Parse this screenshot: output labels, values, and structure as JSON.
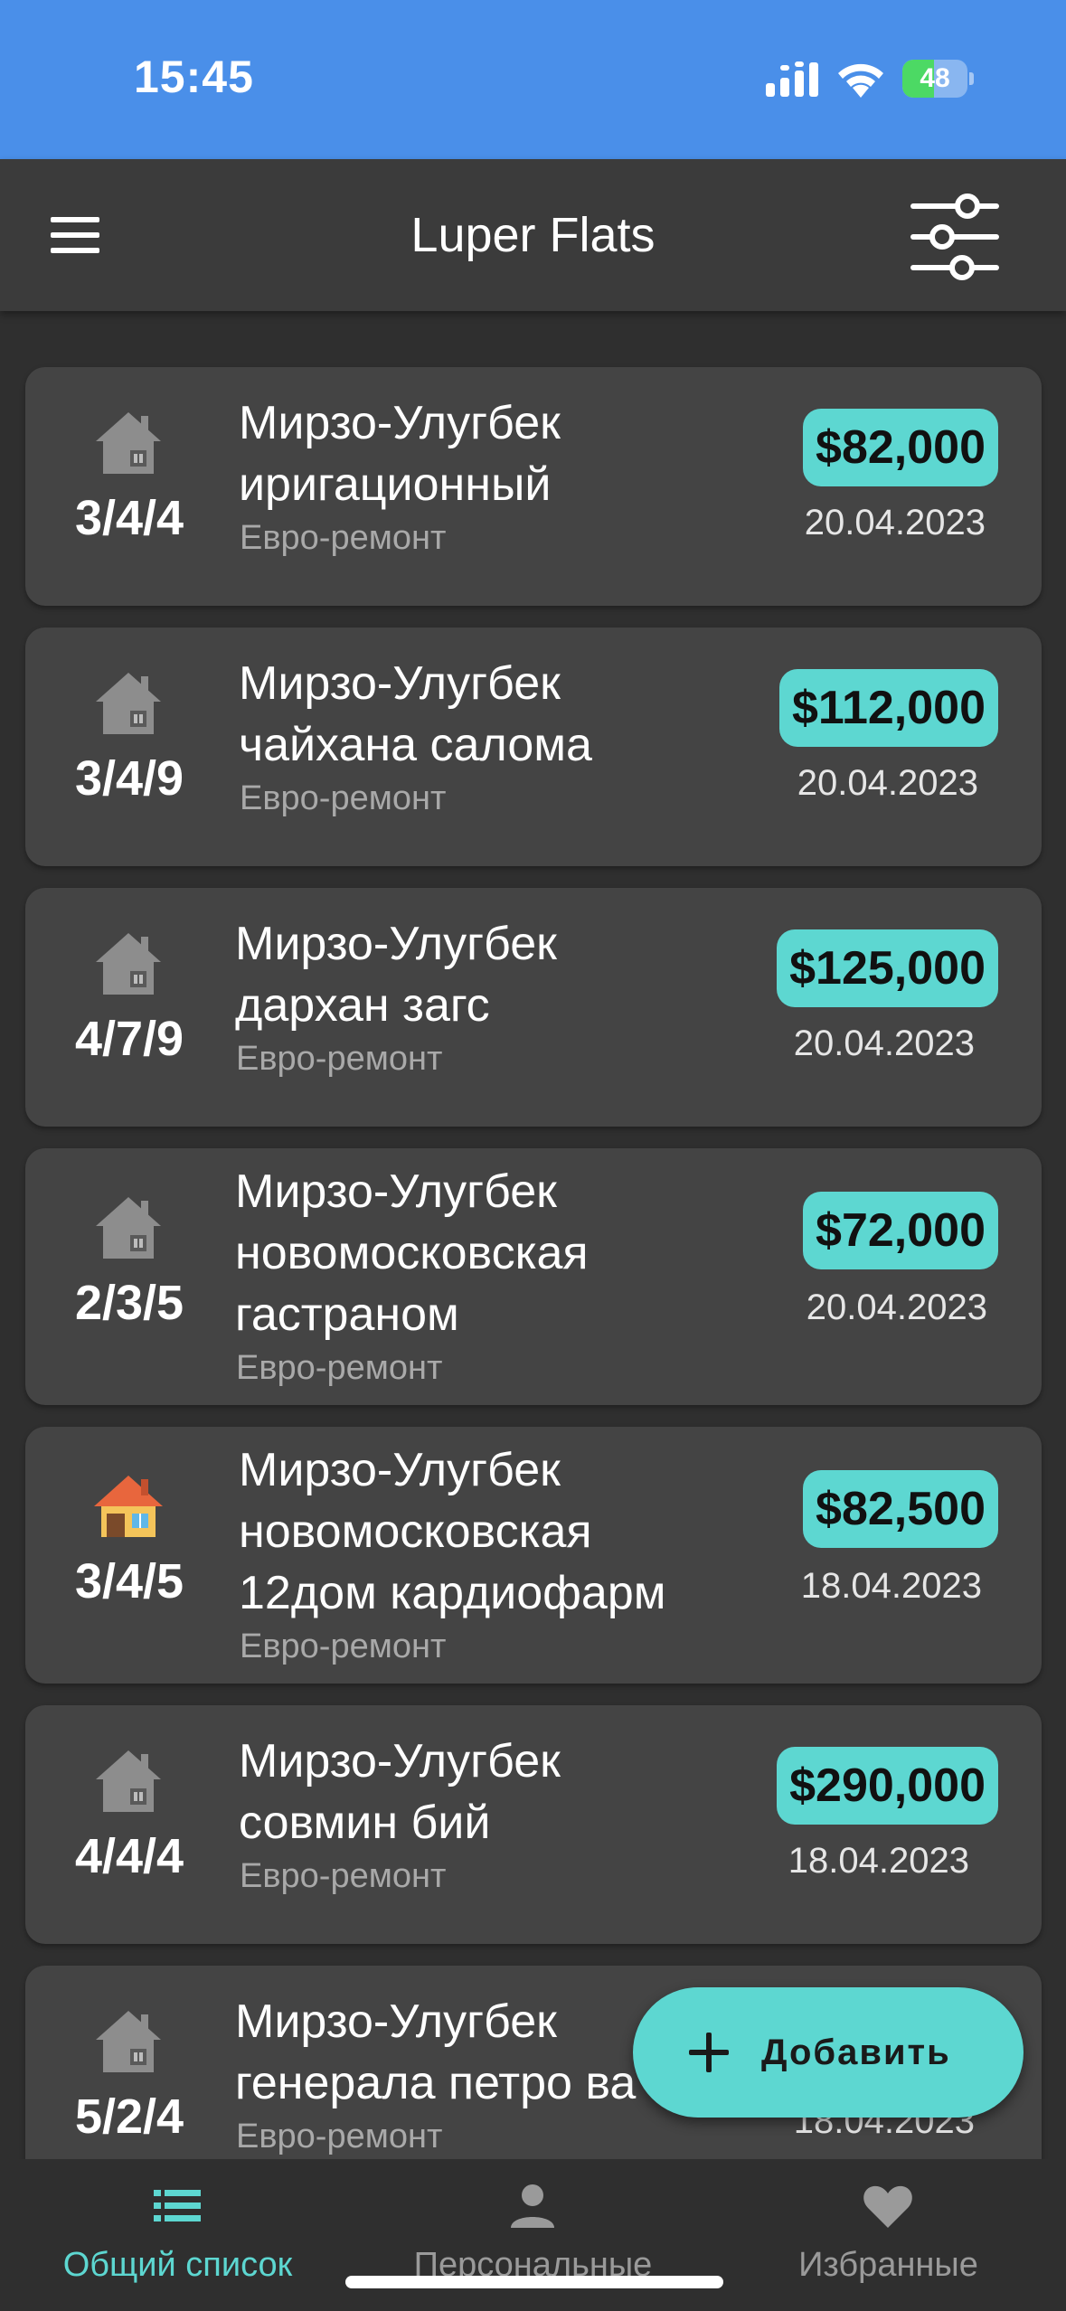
{
  "status_bar": {
    "time": "15:45",
    "battery_level": "48",
    "battery_fraction": 0.48
  },
  "header": {
    "title": "Luper Flats",
    "menu_icon": "hamburger-menu-icon",
    "filter_icon": "sliders-filter-icon"
  },
  "listings": [
    {
      "rooms": "3/4/4",
      "title_lines": [
        "Мирзо-Улугбек",
        "иригационный"
      ],
      "renovation": "Евро-ремонт",
      "price": "$82,000",
      "date": "20.04.2023",
      "icon": "house-gray-icon"
    },
    {
      "rooms": "3/4/9",
      "title_lines": [
        "Мирзо-Улугбек",
        "чайхана салома"
      ],
      "renovation": "Евро-ремонт",
      "price": "$112,000",
      "date": "20.04.2023",
      "icon": "house-gray-icon"
    },
    {
      "rooms": "4/7/9",
      "title_lines": [
        "Мирзо-Улугбек",
        "дархан загс"
      ],
      "renovation": "Евро-ремонт",
      "price": "$125,000",
      "date": "20.04.2023",
      "icon": "house-gray-icon"
    },
    {
      "rooms": "2/3/5",
      "title_lines": [
        "Мирзо-Улугбек",
        "новомосковская",
        "гастраном"
      ],
      "renovation": "Евро-ремонт",
      "price": "$72,000",
      "date": "20.04.2023",
      "icon": "house-gray-icon"
    },
    {
      "rooms": "3/4/5",
      "title_lines": [
        "Мирзо-Улугбек",
        "новомосковская",
        "12дом кардиофарм"
      ],
      "renovation": "Евро-ремонт",
      "price": "$82,500",
      "date": "18.04.2023",
      "icon": "house-color-icon"
    },
    {
      "rooms": "4/4/4",
      "title_lines": [
        "Мирзо-Улугбек",
        "совмин бий"
      ],
      "renovation": "Евро-ремонт",
      "price": "$290,000",
      "date": "18.04.2023",
      "icon": "house-gray-icon"
    },
    {
      "rooms": "5/2/4",
      "title_lines": [
        "Мирзо-Улугбек",
        "генерала петро ва"
      ],
      "renovation": "Евро-ремонт",
      "price": "",
      "date": "18.04.2023",
      "icon": "house-gray-icon"
    }
  ],
  "fab": {
    "label": "Добавить",
    "icon": "plus-icon"
  },
  "bottom_nav": {
    "items": [
      {
        "label": "Общий список",
        "icon": "list-icon",
        "active": true
      },
      {
        "label": "Персональные",
        "icon": "person-icon",
        "active": false
      },
      {
        "label": "Избранные",
        "icon": "heart-icon",
        "active": false
      }
    ]
  },
  "colors": {
    "status_bar": "#4a8fe9",
    "app_bar": "#3b3b3b",
    "background": "#2f2f2f",
    "card": "#444444",
    "accent": "#5dd7d1",
    "muted_text": "#a9a9a9"
  }
}
